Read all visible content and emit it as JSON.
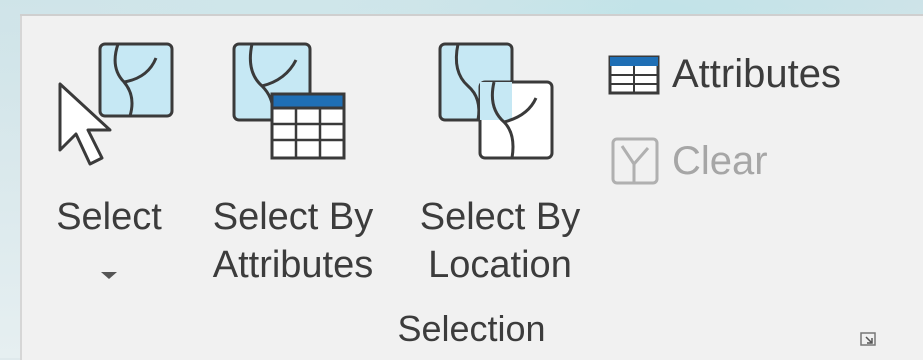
{
  "ribbon": {
    "group_label": "Selection",
    "buttons": {
      "select": {
        "label": "Select",
        "icon": "select-arrow-map-icon"
      },
      "select_by_attributes": {
        "line1": "Select By",
        "line2": "Attributes",
        "icon": "select-by-attributes-icon"
      },
      "select_by_location": {
        "line1": "Select By",
        "line2": "Location",
        "icon": "select-by-location-icon"
      },
      "attributes": {
        "label": "Attributes",
        "icon": "attribute-table-icon"
      },
      "clear": {
        "label": "Clear",
        "icon": "clear-selection-icon",
        "disabled": true
      }
    },
    "colors": {
      "map_fill": "#c6e8f4",
      "map_stroke": "#3a3a3a",
      "table_header": "#1f6fb5",
      "text": "#3c3c3c",
      "disabled_text": "#a6a6a6"
    }
  }
}
